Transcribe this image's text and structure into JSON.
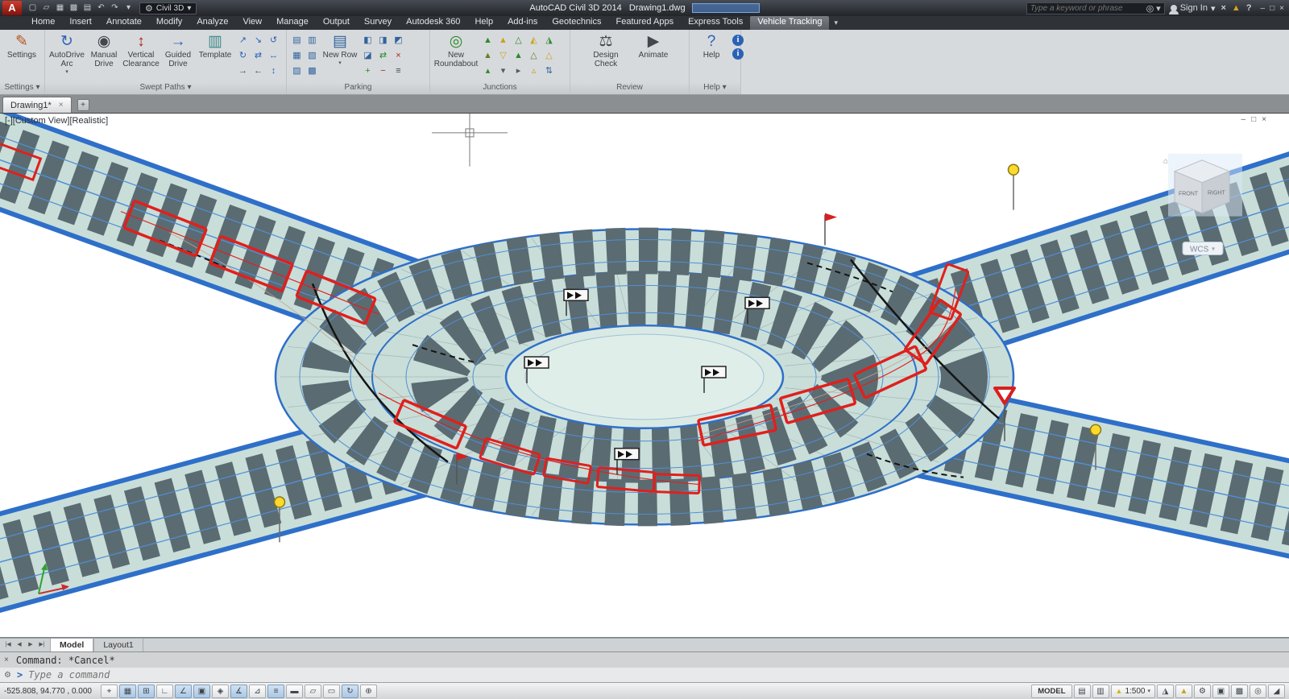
{
  "glyphs": {
    "caret_down": "▾",
    "caret_up": "▴",
    "close": "×",
    "minimize": "–",
    "restore": "□",
    "home": "⌂"
  },
  "titlebar": {
    "logo": "A",
    "workspace": "Civil 3D",
    "title": "AutoCAD Civil 3D 2014   Drawing1.dwg",
    "search_placeholder": "Type a keyword or phrase",
    "sign_in": "Sign In",
    "qat_icons": [
      {
        "n": "new-file-icon",
        "g": "▢"
      },
      {
        "n": "open-file-icon",
        "g": "▱"
      },
      {
        "n": "save-icon",
        "g": "▦"
      },
      {
        "n": "save-as-icon",
        "g": "▩"
      },
      {
        "n": "plot-icon",
        "g": "▤"
      },
      {
        "n": "undo-icon",
        "g": "↶"
      },
      {
        "n": "redo-icon",
        "g": "↷"
      },
      {
        "n": "qat-dropdown-icon",
        "g": "▾"
      }
    ],
    "right_icons": [
      {
        "n": "search-go-icon",
        "g": "◎"
      },
      {
        "n": "exchange-apps-icon",
        "g": "×"
      },
      {
        "n": "alert-icon",
        "g": "▲",
        "c": "#d9a21c"
      },
      {
        "n": "help-icon",
        "g": "?"
      }
    ]
  },
  "ribbon": {
    "active_tab": "Vehicle Tracking",
    "tabs": [
      "Home",
      "Insert",
      "Annotate",
      "Modify",
      "Analyze",
      "View",
      "Manage",
      "Output",
      "Survey",
      "Autodesk 360",
      "Help",
      "Add-ins",
      "Geotechnics",
      "Featured Apps",
      "Express Tools",
      "Vehicle Tracking"
    ],
    "panels": {
      "settings": {
        "label": "Settings",
        "buttons": [
          {
            "n": "settings",
            "label": "Settings",
            "g": "✎",
            "c": "#b3541e"
          }
        ]
      },
      "swept_paths": {
        "label": "Swept Paths",
        "buttons": [
          {
            "n": "autodrive-arc",
            "label": "AutoDrive Arc",
            "g": "↻",
            "c": "#2c62b8",
            "caret": true
          },
          {
            "n": "manual-drive",
            "label": "Manual Drive",
            "g": "◉",
            "c": "#44484c"
          },
          {
            "n": "vertical-clearance",
            "label": "Vertical Clearance",
            "g": "↕",
            "c": "#b32020"
          },
          {
            "n": "guided-drive",
            "label": "Guided Drive",
            "g": "→",
            "c": "#2c62b8"
          },
          {
            "n": "template",
            "label": "Template",
            "g": "▥",
            "c": "#3a8a8a"
          }
        ],
        "grid": [
          {
            "n": "path-forward-icon",
            "g": "↗",
            "c": "#2c62b8"
          },
          {
            "n": "path-reverse-icon",
            "g": "↘",
            "c": "#2c62b8"
          },
          {
            "n": "arc-left-icon",
            "g": "↺",
            "c": "#2c62b8"
          },
          {
            "n": "arc-right-icon",
            "g": "↻",
            "c": "#2c62b8"
          },
          {
            "n": "two-way-path-icon",
            "g": "⇄",
            "c": "#2c62b8"
          },
          {
            "n": "extend-path-icon",
            "g": "↔",
            "c": "#2c62b8"
          },
          {
            "n": "drive-forward-icon",
            "g": "→",
            "c": "#44484c"
          },
          {
            "n": "drive-back-icon",
            "g": "←",
            "c": "#44484c"
          },
          {
            "n": "vertical-path-icon",
            "g": "↕",
            "c": "#2c62b8"
          }
        ]
      },
      "parking": {
        "label": "Parking",
        "buttons": [
          {
            "n": "new-row",
            "label": "New Row",
            "g": "▤",
            "c": "#31639c",
            "caret": true
          }
        ],
        "grid_left": [
          {
            "n": "parking-standards-icon",
            "g": "▤",
            "c": "#31639c"
          },
          {
            "n": "parking-bay-icon",
            "g": "▥",
            "c": "#31639c"
          },
          {
            "n": "parking-island-icon",
            "g": "▦",
            "c": "#31639c"
          },
          {
            "n": "parking-edit-icon",
            "g": "▧",
            "c": "#31639c"
          },
          {
            "n": "parking-split-icon",
            "g": "▨",
            "c": "#31639c"
          },
          {
            "n": "parking-join-icon",
            "g": "▩",
            "c": "#31639c"
          }
        ],
        "grid_right": [
          {
            "n": "row-rotate-icon",
            "g": "◧",
            "c": "#31639c"
          },
          {
            "n": "row-mirror-icon",
            "g": "◨",
            "c": "#31639c"
          },
          {
            "n": "row-align-icon",
            "g": "◩",
            "c": "#31639c"
          },
          {
            "n": "row-offset-icon",
            "g": "◪",
            "c": "#31639c"
          },
          {
            "n": "row-check-icon",
            "g": "⇄",
            "c": "#2d8a2d"
          },
          {
            "n": "row-delete-icon",
            "g": "×",
            "c": "#b32020"
          },
          {
            "n": "bay-add-icon",
            "g": "+",
            "c": "#2d8a2d"
          },
          {
            "n": "bay-remove-icon",
            "g": "−",
            "c": "#b32020"
          },
          {
            "n": "bay-report-icon",
            "g": "≡",
            "c": "#44484c"
          }
        ]
      },
      "junctions": {
        "label": "Junctions",
        "buttons": [
          {
            "n": "new-roundabout",
            "label": "New Roundabout",
            "g": "◎",
            "c": "#2d8a2d"
          }
        ],
        "grid": [
          {
            "n": "t-junction-icon",
            "g": "▲",
            "c": "#2d8a2d"
          },
          {
            "n": "y-junction-icon",
            "g": "▲",
            "c": "#caa21c"
          },
          {
            "n": "crossroads-icon",
            "g": "△",
            "c": "#2d8a2d"
          },
          {
            "n": "staggered-junction-icon",
            "g": "◭",
            "c": "#caa21c"
          },
          {
            "n": "roundabout-arm-icon",
            "g": "◮",
            "c": "#2d8a2d"
          },
          {
            "n": "merge-lane-icon",
            "g": "▲",
            "c": "#6a7e2c"
          },
          {
            "n": "diverge-lane-icon",
            "g": "▽",
            "c": "#caa21c"
          },
          {
            "n": "priority-icon",
            "g": "▲",
            "c": "#2d8a2d"
          },
          {
            "n": "signal-icon",
            "g": "△",
            "c": "#6a7e2c"
          },
          {
            "n": "lane-gain-icon",
            "g": "△",
            "c": "#caa21c"
          },
          {
            "n": "lane-drop-icon",
            "g": "▴",
            "c": "#2d8a2d"
          },
          {
            "n": "chevron-icon",
            "g": "▾",
            "c": "#55595d"
          },
          {
            "n": "flow-arrow-icon",
            "g": "▸",
            "c": "#55595d"
          },
          {
            "n": "island-icon",
            "g": "▵",
            "c": "#caa21c"
          },
          {
            "n": "swap-flow-icon",
            "g": "⇅",
            "c": "#31639c"
          }
        ]
      },
      "review": {
        "label": "Review",
        "buttons": [
          {
            "n": "design-check",
            "label": "Design Check",
            "g": "⚖",
            "c": "#44484c"
          },
          {
            "n": "animate",
            "label": "Animate",
            "g": "▶",
            "c": "#44484c"
          }
        ]
      },
      "help": {
        "label": "Help",
        "buttons": [
          {
            "n": "help",
            "label": "Help",
            "g": "?",
            "c": "#2a62b5"
          }
        ]
      }
    }
  },
  "doc_tabs": {
    "active": "Drawing1*",
    "new_tab_glyph": "+"
  },
  "viewport": {
    "label": "[-][Custom View][Realistic]",
    "viewcube": {
      "front": "FRONT",
      "right": "RIGHT",
      "wcs": "WCS"
    }
  },
  "layout_tabs": {
    "nav_icons": [
      {
        "n": "first-layout-icon",
        "g": "|◀"
      },
      {
        "n": "prev-layout-icon",
        "g": "◀"
      },
      {
        "n": "next-layout-icon",
        "g": "▶"
      },
      {
        "n": "last-layout-icon",
        "g": "▶|"
      }
    ],
    "tabs": [
      "Model",
      "Layout1"
    ],
    "active": "Model"
  },
  "command": {
    "history": "Command: *Cancel*",
    "prompt": ">",
    "placeholder": "Type a command"
  },
  "statusbar": {
    "coords": "-525.808, 94.770 , 0.000",
    "model_label": "MODEL",
    "scale": "1:500",
    "left_icons": [
      {
        "n": "infer-constraints-icon",
        "g": "⌖"
      },
      {
        "n": "snap-mode-icon",
        "g": "▦",
        "active": true
      },
      {
        "n": "grid-display-icon",
        "g": "⊞",
        "active": true
      },
      {
        "n": "ortho-mode-icon",
        "g": "∟"
      },
      {
        "n": "polar-tracking-icon",
        "g": "∠",
        "active": true
      },
      {
        "n": "osnap-icon",
        "g": "▣",
        "active": true
      },
      {
        "n": "osnap-3d-icon",
        "g": "◈"
      },
      {
        "n": "otrack-icon",
        "g": "∡",
        "active": true
      },
      {
        "n": "ducs-icon",
        "g": "⊿"
      },
      {
        "n": "dynamic-input-icon",
        "g": "≡",
        "active": true
      },
      {
        "n": "lineweight-icon",
        "g": "▬"
      },
      {
        "n": "transparency-icon",
        "g": "▱"
      },
      {
        "n": "quick-properties-icon",
        "g": "▭"
      },
      {
        "n": "selection-cycling-icon",
        "g": "↻",
        "active": true
      },
      {
        "n": "annotation-monitor-icon",
        "g": "⊕"
      }
    ],
    "right_icons_a": [
      {
        "n": "quick-view-layouts-icon",
        "g": "▤"
      },
      {
        "n": "quick-view-drawings-icon",
        "g": "▥"
      }
    ],
    "right_icons_b": [
      {
        "n": "annotation-visibility-icon",
        "g": "◮"
      },
      {
        "n": "annotation-autoscale-icon",
        "g": "▲",
        "c": "#caa21c"
      },
      {
        "n": "workspace-switch-icon",
        "g": "⚙"
      },
      {
        "n": "toolbar-lock-icon",
        "g": "▣"
      },
      {
        "n": "hardware-accel-icon",
        "g": "▩"
      },
      {
        "n": "isolate-objects-icon",
        "g": "◎"
      },
      {
        "n": "clean-screen-icon",
        "g": "◢"
      }
    ]
  }
}
